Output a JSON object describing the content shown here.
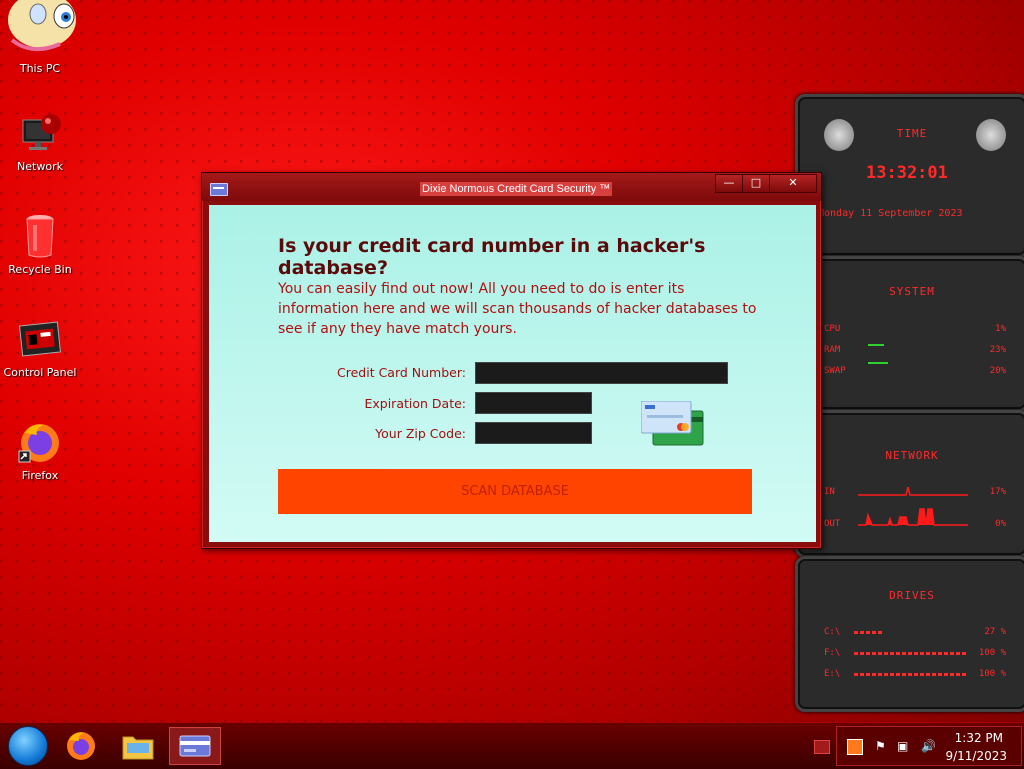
{
  "desktop": {
    "icons": [
      {
        "label": "This PC"
      },
      {
        "label": "Network"
      },
      {
        "label": "Recycle Bin"
      },
      {
        "label": "Control Panel"
      },
      {
        "label": "Firefox"
      }
    ]
  },
  "window": {
    "title": "Dixie Normous Credit Card Security ™",
    "heading": "Is your credit card number in a hacker's database?",
    "description": "You can easily find out now! All you need to do is enter its information here and we will scan thousands of hacker databases to see if any they have match yours.",
    "form": {
      "card_number_label": "Credit Card Number:",
      "card_number_value": "",
      "expiration_label": "Expiration Date:",
      "expiration_value": "",
      "zip_label": "Your Zip Code:",
      "zip_value": ""
    },
    "scan_button": "SCAN DATABASE"
  },
  "gadgets": {
    "time": {
      "header": "TIME",
      "clock": "13:32:01",
      "date": "Monday 11 September 2023"
    },
    "system": {
      "header": "SYSTEM",
      "rows": [
        {
          "name": "CPU",
          "value": "1%"
        },
        {
          "name": "RAM",
          "value": "23%"
        },
        {
          "name": "SWAP",
          "value": "20%"
        }
      ]
    },
    "network": {
      "header": "NETWORK",
      "rows": [
        {
          "name": "IN",
          "value": "17%"
        },
        {
          "name": "OUT",
          "value": "0%"
        }
      ]
    },
    "drives": {
      "header": "DRIVES",
      "rows": [
        {
          "name": "C:\\",
          "value": "27 %"
        },
        {
          "name": "F:\\",
          "value": "100 %"
        },
        {
          "name": "E:\\",
          "value": "100 %"
        }
      ]
    }
  },
  "taskbar": {
    "clock_time": "1:32 PM",
    "clock_date": "9/11/2023"
  },
  "colors": {
    "accent": "#ff4400",
    "desktop_red": "#e00000",
    "window_bg": "#abf1e6"
  }
}
